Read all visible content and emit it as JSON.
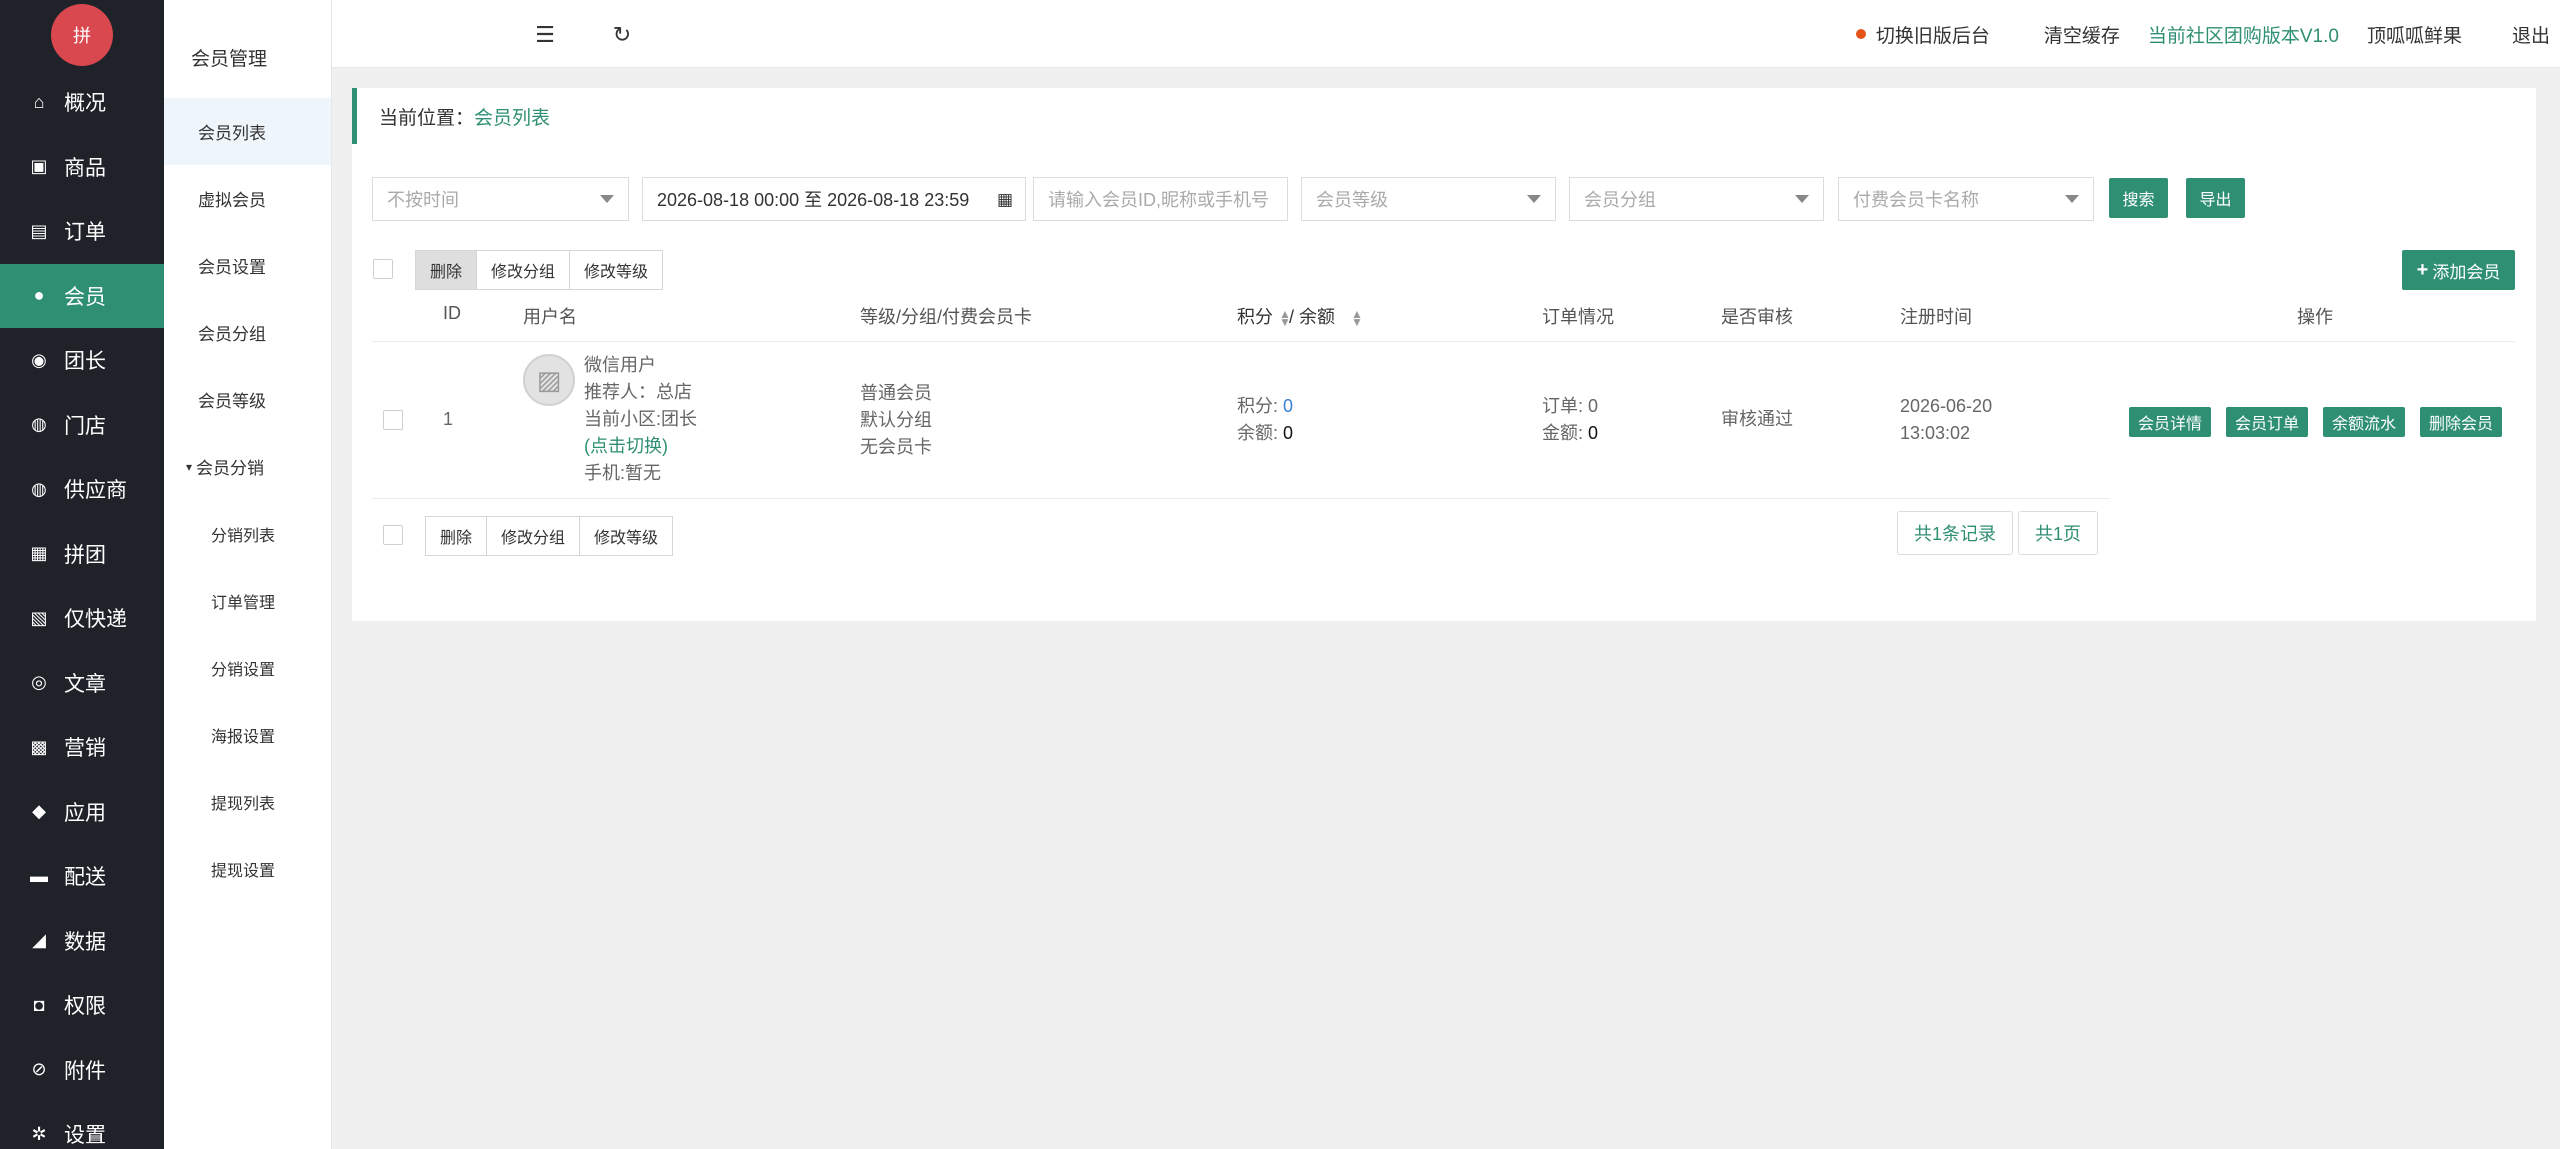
{
  "logo": {
    "glyph": "拼"
  },
  "sidebar": {
    "items": [
      {
        "label": "概况",
        "icon": "home-icon",
        "glyph": "⌂"
      },
      {
        "label": "商品",
        "icon": "goods-icon",
        "glyph": "▣"
      },
      {
        "label": "订单",
        "icon": "order-icon",
        "glyph": "▤"
      },
      {
        "label": "会员",
        "icon": "member-icon",
        "glyph": "●",
        "active": true
      },
      {
        "label": "团长",
        "icon": "leader-icon",
        "glyph": "◉"
      },
      {
        "label": "门店",
        "icon": "store-icon",
        "glyph": "◍"
      },
      {
        "label": "供应商",
        "icon": "supplier-icon",
        "glyph": "◍"
      },
      {
        "label": "拼团",
        "icon": "group-buy-icon",
        "glyph": "▦"
      },
      {
        "label": "仅快递",
        "icon": "express-icon",
        "glyph": "▧"
      },
      {
        "label": "文章",
        "icon": "article-icon",
        "glyph": "◎"
      },
      {
        "label": "营销",
        "icon": "gift-icon",
        "glyph": "▩"
      },
      {
        "label": "应用",
        "icon": "cube-icon",
        "glyph": "◆"
      },
      {
        "label": "配送",
        "icon": "truck-icon",
        "glyph": "▬"
      },
      {
        "label": "数据",
        "icon": "chart-icon",
        "glyph": "◢"
      },
      {
        "label": "权限",
        "icon": "lock-icon",
        "glyph": "◘"
      },
      {
        "label": "附件",
        "icon": "clip-icon",
        "glyph": "⊘"
      },
      {
        "label": "设置",
        "icon": "gear-icon",
        "glyph": "✲"
      }
    ]
  },
  "subnav": {
    "title": "会员管理",
    "items": [
      "会员列表",
      "虚拟会员",
      "会员设置",
      "会员分组",
      "会员等级"
    ],
    "group": "会员分销",
    "children": [
      "分销列表",
      "订单管理",
      "分销设置",
      "海报设置",
      "提现列表",
      "提现设置"
    ]
  },
  "topbar": {
    "switch_old": "切换旧版后台",
    "clear_cache": "清空缓存",
    "version": "当前社区团购版本V1.0",
    "shop": "顶呱呱鲜果",
    "logout": "退出"
  },
  "breadcrumb": {
    "prefix": "当前位置：",
    "current": "会员列表"
  },
  "filters": {
    "time": "不按时间",
    "date_range": "2026-08-18 00:00 至 2026-08-18 23:59",
    "keyword_placeholder": "请输入会员ID,昵称或手机号",
    "level": "会员等级",
    "group": "会员分组",
    "card": "付费会员卡名称",
    "search": "搜索",
    "export": "导出"
  },
  "bulk": {
    "delete": "删除",
    "edit_group": "修改分组",
    "edit_level": "修改等级"
  },
  "add_member": "添加会员",
  "table": {
    "headers": {
      "id": "ID",
      "username": "用户名",
      "level": "等级/分组/付费会员卡",
      "points": "积分",
      "balance": "/ 余额",
      "orders": "订单情况",
      "audit": "是否审核",
      "reg": "注册时间",
      "ops": "操作"
    },
    "rows": [
      {
        "id": "1",
        "nickname": "微信用户",
        "referrer": "推荐人：总店",
        "community": "当前小区:团长",
        "switch": "(点击切换)",
        "phone": "手机:暂无",
        "level": "普通会员",
        "group": "默认分组",
        "card": "无会员卡",
        "points_label": "积分: ",
        "points": "0",
        "balance_label": "余额: ",
        "balance": "0",
        "orders_label": "订单: 0",
        "amount_label": "金额: ",
        "amount": "0",
        "audit": "审核通过",
        "reg_date": "2026-06-20",
        "reg_time": "13:03:02",
        "actions": [
          "会员详情",
          "会员订单",
          "余额流水",
          "删除会员"
        ]
      }
    ]
  },
  "pagination": {
    "records": "共1条记录",
    "pages": "共1页"
  }
}
